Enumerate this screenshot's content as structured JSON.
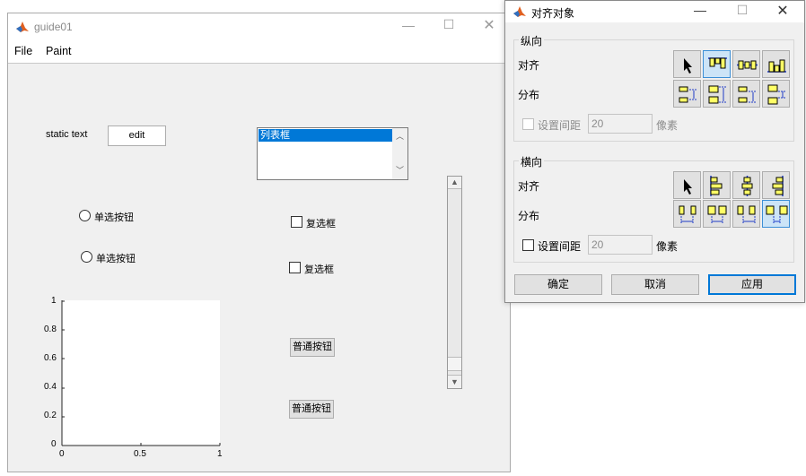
{
  "guide_window": {
    "title": "guide01",
    "menu": [
      "File",
      "Paint"
    ],
    "static_text": "static text",
    "edit_value": "edit",
    "listbox_items": [
      "列表框"
    ],
    "radio_buttons": [
      "单选按钮",
      "单选按钮"
    ],
    "checkboxes": [
      "复选框",
      "复选框"
    ],
    "push_buttons": [
      "普通按钮",
      "普通按钮"
    ],
    "axes": {
      "x_ticks": [
        "0",
        "0.5",
        "1"
      ],
      "y_ticks": [
        "0",
        "0.2",
        "0.4",
        "0.6",
        "0.8",
        "1"
      ]
    }
  },
  "align_dialog": {
    "title": "对齐对象",
    "vertical": {
      "group_title": "纵向",
      "align_label": "对齐",
      "distribute_label": "分布",
      "spacing_label": "设置间距",
      "spacing_value": "20",
      "unit_label": "像素"
    },
    "horizontal": {
      "group_title": "横向",
      "align_label": "对齐",
      "distribute_label": "分布",
      "spacing_label": "设置间距",
      "spacing_value": "20",
      "unit_label": "像素"
    },
    "buttons": {
      "ok": "确定",
      "cancel": "取消",
      "apply": "应用"
    }
  },
  "icons": {
    "app_icon": "matlab-logo-icon",
    "minimize": "minimize-icon",
    "maximize": "maximize-icon",
    "close": "close-icon"
  },
  "colors": {
    "selection_blue": "#0078d7",
    "tool_selected_bg": "#cce4f7",
    "tool_icon_yellow": "#ffff66",
    "tool_icon_blue": "#1e3cc8"
  }
}
